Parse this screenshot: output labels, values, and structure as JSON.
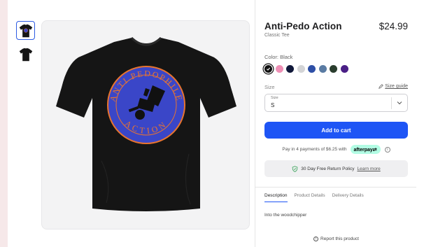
{
  "product": {
    "title": "Anti-Pedo Action",
    "price": "$24.99",
    "subtitle": "Classic Tee"
  },
  "design": {
    "top_text": "ANTI PEDOPHILE",
    "bottom_text": "ACTION"
  },
  "color": {
    "label": "Color: Black",
    "swatches": [
      {
        "name": "Black",
        "hex": "#111111",
        "selected": true
      },
      {
        "name": "Pink",
        "hex": "#ee8fb5",
        "selected": false
      },
      {
        "name": "Navy",
        "hex": "#10183a",
        "selected": false
      },
      {
        "name": "Light Gray",
        "hex": "#d3d4d6",
        "selected": false
      },
      {
        "name": "Royal Blue",
        "hex": "#2e4fa6",
        "selected": false
      },
      {
        "name": "Slate Blue",
        "hex": "#5a7ba3",
        "selected": false
      },
      {
        "name": "Forest Green",
        "hex": "#2a3d2e",
        "selected": false
      },
      {
        "name": "Purple",
        "hex": "#4a1f86",
        "selected": false
      }
    ]
  },
  "size": {
    "label": "Size",
    "guide_label": "Size guide",
    "select_label": "Size",
    "selected": "S"
  },
  "cart": {
    "add_label": "Add to cart"
  },
  "afterpay": {
    "text": "Pay in 4 payments of $6.25 with",
    "badge": "afterpay⇄"
  },
  "returns": {
    "text": "30 Day Free Return Policy",
    "link": "Learn more"
  },
  "tabs": [
    {
      "label": "Description",
      "active": true
    },
    {
      "label": "Product Details",
      "active": false
    },
    {
      "label": "Delivery Details",
      "active": false
    }
  ],
  "description": "Into the woodchipper",
  "report_label": "Report this product",
  "colors": {
    "accent": "#1e55f5",
    "shirt": "#151515",
    "emblem": "#3a46c8",
    "emblem_text": "#e8742f"
  }
}
